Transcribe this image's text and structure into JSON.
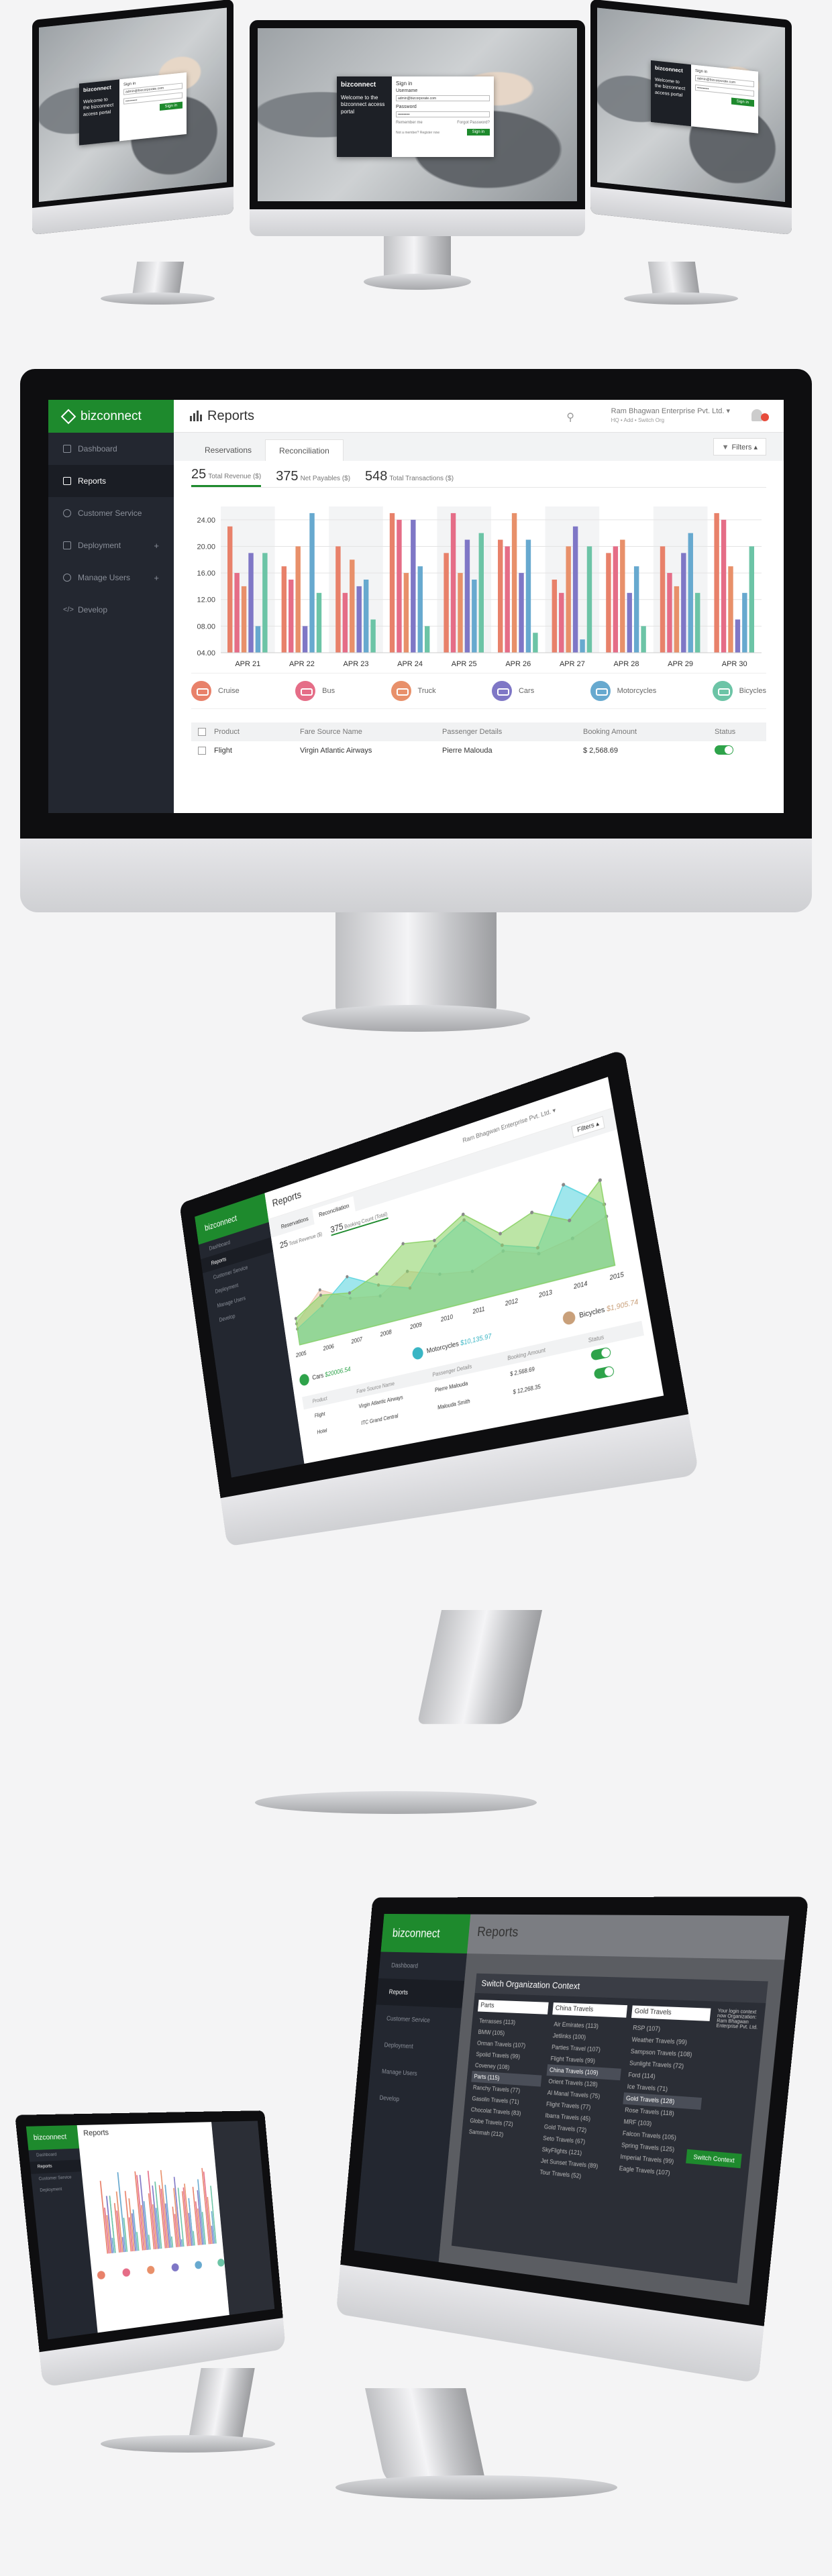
{
  "login": {
    "brand": "bizconnect",
    "welcome": "Welcome to the bizconnect access portal",
    "heading": "Sign in",
    "username_label": "Username",
    "username_value": "admin@bizcorporate.com",
    "password_label": "Password",
    "password_value": "••••••••••",
    "remember": "Remember me",
    "forgot": "Forgot Password?",
    "signin": "Sign in",
    "footer": "Not a member? Register now"
  },
  "app": {
    "brand": "bizconnect",
    "page_title": "Reports",
    "org_name": "Ram Bhagwan Enterprise Pvt. Ltd. ▾",
    "org_meta": "HQ   •   Add   •   Switch Org",
    "nav": [
      {
        "label": "Dashboard"
      },
      {
        "label": "Reports"
      },
      {
        "label": "Customer Service"
      },
      {
        "label": "Deployment"
      },
      {
        "label": "Manage Users"
      },
      {
        "label": "Develop"
      }
    ],
    "tabs": [
      "Reservations",
      "Reconciliation"
    ],
    "filters_label": "Filters ▴",
    "stats": [
      {
        "value": "25",
        "label": "Total Revenue ($)"
      },
      {
        "value": "375",
        "label": "Net Payables ($)"
      },
      {
        "value": "548",
        "label": "Total Transactions ($)"
      }
    ],
    "legend": [
      {
        "label": "Cruise",
        "color": "#e8816a"
      },
      {
        "label": "Bus",
        "color": "#e56d87"
      },
      {
        "label": "Truck",
        "color": "#e8906a"
      },
      {
        "label": "Cars",
        "color": "#7f77c6"
      },
      {
        "label": "Motorcycles",
        "color": "#67a9cf"
      },
      {
        "label": "Bicycles",
        "color": "#6cc4a6"
      }
    ],
    "table": {
      "headers": [
        "Product",
        "Fare Source Name",
        "Passenger Details",
        "Booking Amount",
        "Status"
      ],
      "rows": [
        [
          "Flight",
          "Virgin Atlantic Airways",
          "Pierre Malouda",
          "$ 2,568.69",
          ""
        ]
      ]
    }
  },
  "area_view": {
    "stats": [
      {
        "value": "25",
        "label": "Total Revenue ($)"
      },
      {
        "value": "375",
        "label": "Booking Count (Total)"
      }
    ],
    "legend": [
      {
        "label": "Cars",
        "value": "$20006.54",
        "color": "#2ea34a"
      },
      {
        "label": "Motorcycles",
        "value": "$10,135.97",
        "color": "#39b5c4"
      },
      {
        "label": "Bicycles",
        "value": "$1,905.74",
        "color": "#c9a07a"
      }
    ],
    "table_headers": [
      "Product",
      "Fare Source Name",
      "Passenger Details",
      "Booking Amount",
      "Status"
    ],
    "rows": [
      [
        "Flight",
        "Virgin Atlantic Airways",
        "Pierre Malouda",
        "$ 2,568.69"
      ],
      [
        "Hotel",
        "ITC Grand Central",
        "Malouda Smith",
        "$ 12,268.35"
      ]
    ]
  },
  "switch_modal": {
    "title": "Switch Organization Context",
    "columns": [
      {
        "header": "Parts",
        "items": [
          "Terrasses (113)",
          "BMW (105)",
          "Orman Travels (107)",
          "Spolid Travels (99)",
          "Coveney (108)",
          "Parts (115)",
          "Ranchy Travels (77)",
          "Gasolin Travels (71)",
          "Chocolat Travels (83)",
          "Globe Travels (72)",
          "Sammah (212)"
        ],
        "selected": 5
      },
      {
        "header": "China Travels",
        "items": [
          "Air Emirates (113)",
          "Jetlinks (100)",
          "Parties Travel (107)",
          "Flight Travels (99)",
          "China Travels (109)",
          "Orient Travels (128)",
          "Al Manal Travels (75)",
          "Flight Travels (77)",
          "Ibarra Travels (45)",
          "Gold Travels (72)",
          "Seto Travels (67)",
          "SkyFlights (121)",
          "Jet Sunset Travels (89)",
          "Tour Travels (52)"
        ],
        "selected": 4
      },
      {
        "header": "Gold Travels",
        "items": [
          "RSP (107)",
          "Weather Travels (99)",
          "Sampson Travels (108)",
          "Sunlight Travels (72)",
          "Ford (114)",
          "Ice Travels (71)",
          "Gold Travels (128)",
          "Rose Travels (118)",
          "MRF (103)",
          "Falcon Travels (105)",
          "Spring Travels (125)",
          "Imperial Travels (99)",
          "Eagle Travels (107)"
        ],
        "selected": 6
      }
    ],
    "switch_btn": "Switch Context",
    "side_note": "Your login context now Organization: Ram Bhagwan Enterprise Pvt. Ltd."
  },
  "chart_data": [
    {
      "type": "bar",
      "categories": [
        "APR 21",
        "APR 22",
        "APR 23",
        "APR 24",
        "APR 25",
        "APR 26",
        "APR 27",
        "APR 28",
        "APR 29",
        "APR 30"
      ],
      "ylim": [
        4,
        26
      ],
      "yticks": [
        "04.00",
        "08.00",
        "12.00",
        "16.00",
        "20.00",
        "24.00"
      ],
      "grid": true,
      "series": [
        {
          "name": "Cruise",
          "color": "#e8816a",
          "values": [
            23,
            17,
            20,
            25,
            19,
            21,
            15,
            19,
            20,
            25
          ]
        },
        {
          "name": "Bus",
          "color": "#e56d87",
          "values": [
            16,
            15,
            13,
            24,
            25,
            20,
            13,
            20,
            16,
            24
          ]
        },
        {
          "name": "Truck",
          "color": "#e8906a",
          "values": [
            14,
            20,
            18,
            16,
            16,
            25,
            20,
            21,
            14,
            17
          ]
        },
        {
          "name": "Cars",
          "color": "#7f77c6",
          "values": [
            19,
            8,
            14,
            24,
            21,
            16,
            23,
            13,
            19,
            9
          ]
        },
        {
          "name": "Motorcycles",
          "color": "#67a9cf",
          "values": [
            8,
            25,
            15,
            17,
            15,
            21,
            6,
            17,
            22,
            13
          ]
        },
        {
          "name": "Bicycles",
          "color": "#6cc4a6",
          "values": [
            19,
            13,
            9,
            8,
            22,
            7,
            20,
            8,
            13,
            20
          ]
        }
      ]
    },
    {
      "type": "area",
      "x": [
        "2005",
        "2006",
        "2007",
        "2008",
        "2009",
        "2010",
        "2011",
        "2012",
        "2013",
        "2014",
        "2015"
      ],
      "series": [
        {
          "name": "Cars",
          "color": "#8fd36b",
          "values": [
            10,
            16,
            14,
            18,
            26,
            24,
            30,
            20,
            24,
            18,
            28
          ]
        },
        {
          "name": "Motorcycles",
          "color": "#5fd6e0",
          "values": [
            6,
            12,
            20,
            14,
            10,
            22,
            28,
            16,
            12,
            30,
            20
          ]
        },
        {
          "name": "Bicycles",
          "color": "#f0c8b0",
          "values": [
            8,
            18,
            12,
            10,
            16,
            12,
            10,
            14,
            10,
            12,
            16
          ]
        }
      ]
    }
  ]
}
